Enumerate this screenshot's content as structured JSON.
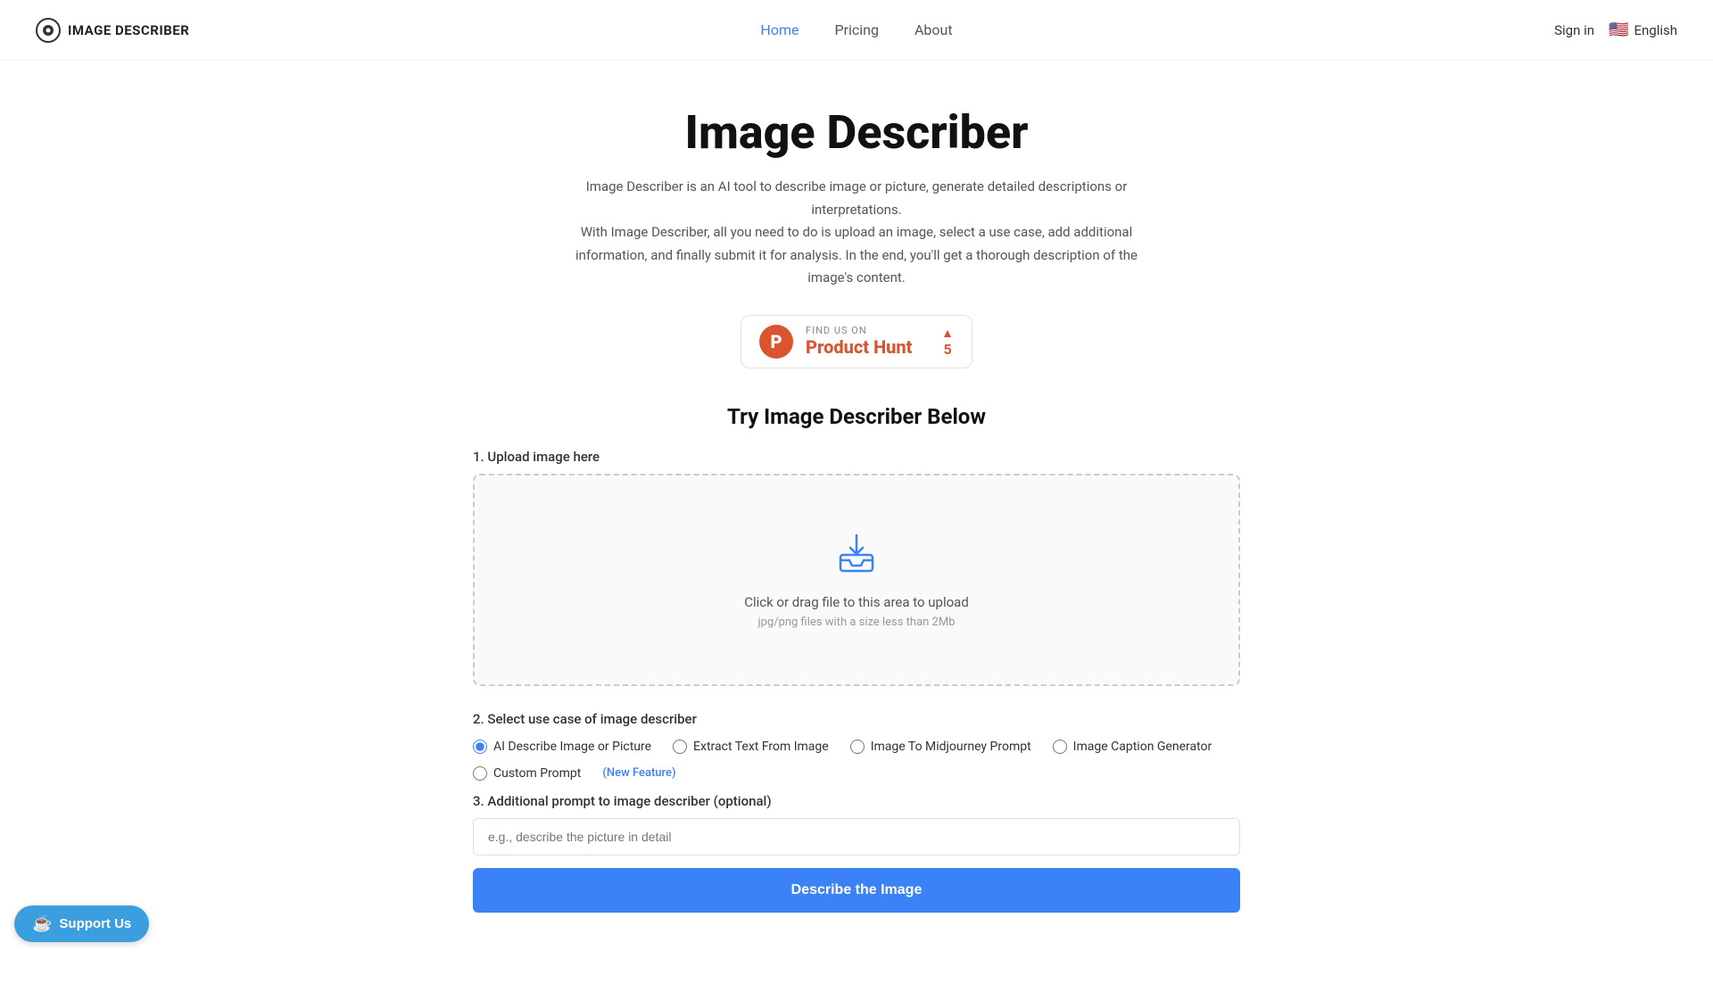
{
  "nav": {
    "logo_text": "IMAGE DESCRIBER",
    "links": [
      {
        "label": "Home",
        "active": true
      },
      {
        "label": "Pricing",
        "active": false
      },
      {
        "label": "About",
        "active": false
      }
    ],
    "sign_in": "Sign in",
    "language": "English"
  },
  "hero": {
    "title": "Image Describer",
    "subtitle_line1": "Image Describer is an AI tool to describe image or picture, generate detailed descriptions or interpretations.",
    "subtitle_line2": "With Image Describer, all you need to do is upload an image, select a use case, add additional information, and finally submit it for analysis. In the end, you'll get a thorough description of the image's content."
  },
  "product_hunt": {
    "find_us": "FIND US ON",
    "name": "Product Hunt",
    "vote_count": "5"
  },
  "section": {
    "try_title": "Try Image Describer Below"
  },
  "upload": {
    "label": "1. Upload image here",
    "drag_text": "Click or drag file to this area to upload",
    "hint": "jpg/png files with a size less than 2Mb"
  },
  "use_case": {
    "label": "2. Select use case of image describer",
    "options": [
      {
        "id": "ai-describe",
        "label": "AI Describe Image or Picture",
        "checked": true
      },
      {
        "id": "extract-text",
        "label": "Extract Text From Image",
        "checked": false
      },
      {
        "id": "midjourney",
        "label": "Image To Midjourney Prompt",
        "checked": false
      },
      {
        "id": "caption",
        "label": "Image Caption Generator",
        "checked": false
      },
      {
        "id": "custom",
        "label": "Custom Prompt",
        "checked": false
      }
    ],
    "new_feature_label": "(New Feature)"
  },
  "prompt": {
    "label": "3. Additional prompt to image describer (optional)",
    "placeholder": "e.g., describe the picture in detail"
  },
  "submit": {
    "label": "Describe the Image"
  },
  "support": {
    "label": "Support Us"
  }
}
